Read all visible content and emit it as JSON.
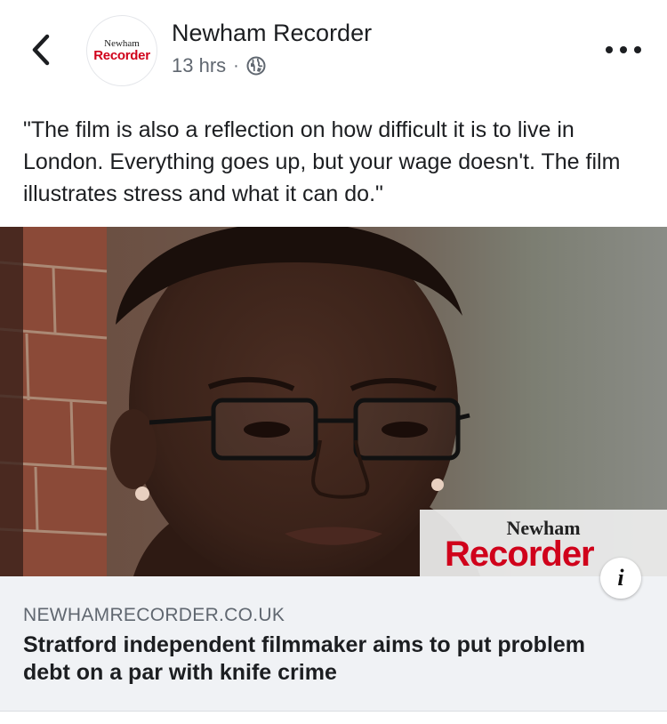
{
  "post": {
    "page_name": "Newham Recorder",
    "timestamp": "13 hrs",
    "separator": "·",
    "text": "\"The film is also a reflection on how difficult it is to live in London. Everything goes up, but your wage doesn't. The film illustrates stress and what it can do.\""
  },
  "avatar": {
    "line1": "Newham",
    "line2": "Recorder"
  },
  "image": {
    "watermark_top": "Newham",
    "watermark_bottom": "Recorder",
    "info_label": "i"
  },
  "link": {
    "domain": "NEWHAMRECORDER.CO.UK",
    "headline": "Stratford independent filmmaker aims to put problem debt on a par with knife crime"
  },
  "icons": {
    "back": "chevron-left-icon",
    "privacy": "globe-icon",
    "more": "more-options-icon",
    "info": "info-icon"
  },
  "colors": {
    "brand_red": "#d0021b",
    "card_bg": "#f0f2f5",
    "meta_text": "#606770"
  }
}
